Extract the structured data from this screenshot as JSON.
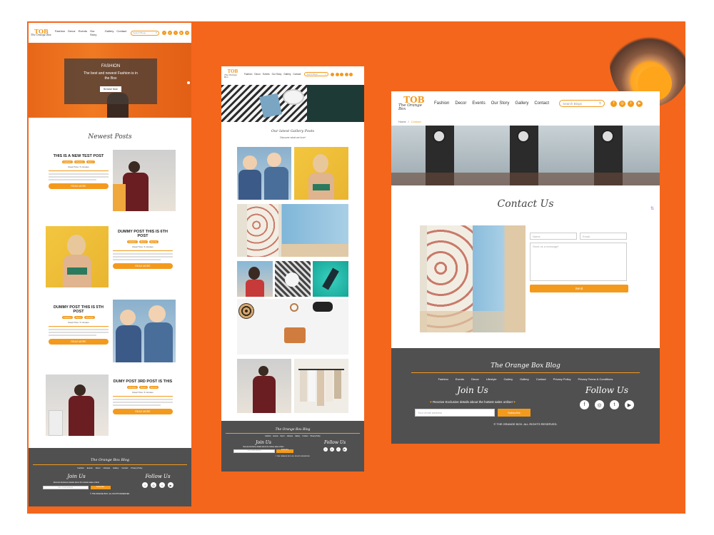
{
  "brand": {
    "mark": "TOB",
    "name": "The Orange Box"
  },
  "nav": [
    "Fashion",
    "Decor",
    "Events",
    "Our Story",
    "Gallery",
    "Contact"
  ],
  "search_placeholder": "Search Blogs",
  "hero": {
    "title": "FASHION",
    "subtitle": "The best and newest Fashion is in the Box",
    "cta": "Browse Now"
  },
  "posts_page": {
    "heading": "Newest Posts",
    "posts": [
      {
        "title": "THIS IS A NEW TEST POST",
        "tags": [
          "Fashion",
          "Lifestyle",
          "Decor"
        ],
        "meta": "Read Time: 5 minutes",
        "cta": "READ MORE"
      },
      {
        "title": "DUMMY POST THIS IS 6TH POST",
        "tags": [
          "Fashion",
          "Decor",
          "Events"
        ],
        "meta": "Read Time: 5 minutes",
        "cta": "READ MORE"
      },
      {
        "title": "DUMMY POST THIS IS 5TH POST",
        "tags": [
          "Fashion",
          "Decor",
          "Lifestyle"
        ],
        "meta": "Read Time: 5 minutes",
        "cta": "READ MORE"
      },
      {
        "title": "DUMY POST 3RD POST IS THIS",
        "tags": [
          "Lifestyle",
          "Decor",
          "Events"
        ],
        "meta": "Read Time: 5 minutes",
        "cta": "READ MORE"
      }
    ]
  },
  "gallery_page": {
    "heading": "Our latest Gallery Posts",
    "subheading": "Discover what we love!"
  },
  "contact_page": {
    "breadcrumb": [
      "Home",
      "Contact"
    ],
    "heading": "Contact Us",
    "form": {
      "name_placeholder": "Name",
      "email_placeholder": "Email",
      "message_placeholder": "Send us a message!",
      "submit": "Send"
    }
  },
  "footer": {
    "title": "The Orange Box Blog",
    "links": [
      "Fashion",
      "Events",
      "Decor",
      "Lifestyle",
      "Gallery",
      "Gallery",
      "Contact",
      "Privacy Policy",
      "Privacy Terms & Conditions"
    ],
    "join_title": "Join Us",
    "join_text": "Receive Exclusive details about the hottest sales online!",
    "email_placeholder": "Your email address",
    "subscribe": "Subscribe",
    "follow_title": "Follow Us",
    "copyright": "© THE ORANGE BOX. ALL RIGHTS RESERVED."
  },
  "colors": {
    "background": "#f4661c",
    "accent": "#f39a1c",
    "footer": "#505050"
  },
  "icons": [
    "search-icon",
    "facebook-icon",
    "instagram-icon",
    "twitter-icon",
    "youtube-icon",
    "heart-icon"
  ]
}
